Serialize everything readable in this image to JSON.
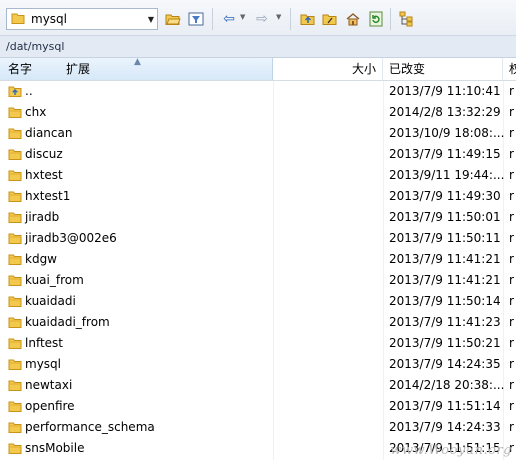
{
  "toolbar": {
    "location_value": "mysql",
    "buttons": [
      "open-folder",
      "filter",
      "back",
      "forward",
      "parent-folder",
      "root-folder",
      "home",
      "refresh",
      "tree-view"
    ]
  },
  "path": "/dat/mysql",
  "columns": {
    "name": "名字",
    "ext": "扩展",
    "size": "大小",
    "changed": "已改变",
    "extra": "权"
  },
  "rows": [
    {
      "name": "..",
      "date": "2013/7/9 11:10:41",
      "extra": "r",
      "type": "up"
    },
    {
      "name": "chx",
      "date": "2014/2/8 13:32:29",
      "extra": "r",
      "type": "folder"
    },
    {
      "name": "diancan",
      "date": "2013/10/9 18:08:...",
      "extra": "r",
      "type": "folder"
    },
    {
      "name": "discuz",
      "date": "2013/7/9 11:49:15",
      "extra": "r",
      "type": "folder"
    },
    {
      "name": "hxtest",
      "date": "2013/9/11 19:44:...",
      "extra": "r",
      "type": "folder"
    },
    {
      "name": "hxtest1",
      "date": "2013/7/9 11:49:30",
      "extra": "r",
      "type": "folder"
    },
    {
      "name": "jiradb",
      "date": "2013/7/9 11:50:01",
      "extra": "r",
      "type": "folder"
    },
    {
      "name": "jiradb3@002e6",
      "date": "2013/7/9 11:50:11",
      "extra": "r",
      "type": "folder"
    },
    {
      "name": "kdgw",
      "date": "2013/7/9 11:41:21",
      "extra": "r",
      "type": "folder"
    },
    {
      "name": "kuai_from",
      "date": "2013/7/9 11:41:21",
      "extra": "r",
      "type": "folder"
    },
    {
      "name": "kuaidadi",
      "date": "2013/7/9 11:50:14",
      "extra": "r",
      "type": "folder"
    },
    {
      "name": "kuaidadi_from",
      "date": "2013/7/9 11:41:23",
      "extra": "r",
      "type": "folder"
    },
    {
      "name": "lnftest",
      "date": "2013/7/9 11:50:21",
      "extra": "r",
      "type": "folder"
    },
    {
      "name": "mysql",
      "date": "2013/7/9 14:24:35",
      "extra": "r",
      "type": "folder"
    },
    {
      "name": "newtaxi",
      "date": "2014/2/18 20:38:...",
      "extra": "r",
      "type": "folder"
    },
    {
      "name": "openfire",
      "date": "2013/7/9 11:51:14",
      "extra": "r",
      "type": "folder"
    },
    {
      "name": "performance_schema",
      "date": "2013/7/9 14:24:33",
      "extra": "r",
      "type": "folder"
    },
    {
      "name": "snsMobile",
      "date": "2013/7/9 11:51:15",
      "extra": "r",
      "type": "folder"
    }
  ],
  "watermark": "www.Wooyun.org",
  "colors": {
    "folder": "#f2c94c",
    "folder_dark": "#d9a520",
    "header_sel": "#d6e8f8",
    "pathbar": "#e4eaf3"
  }
}
